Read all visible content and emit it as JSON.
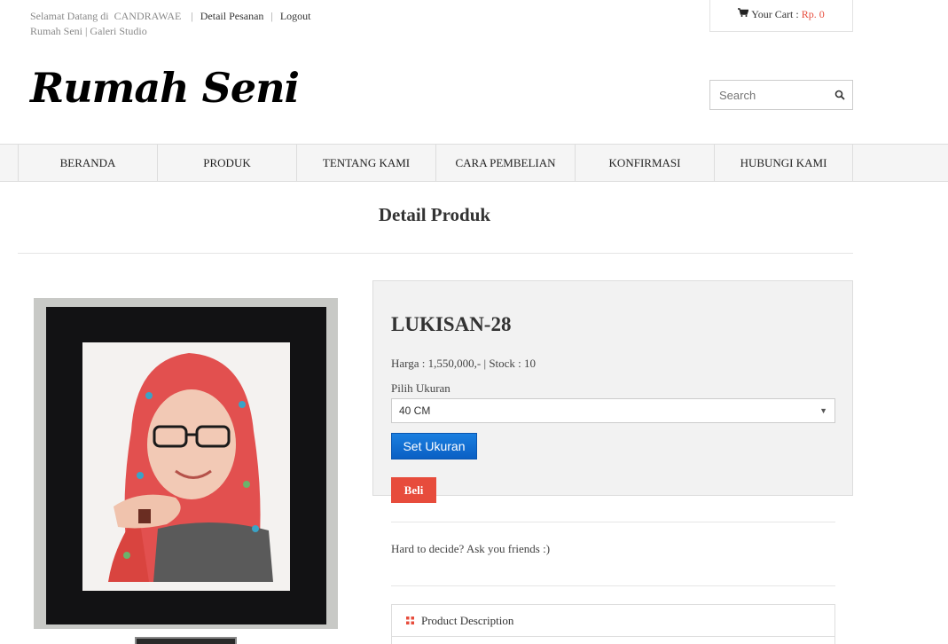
{
  "topbar": {
    "welcome": "Selamat Datang di",
    "username": "CANDRAWAE",
    "order_detail": "Detail Pesanan",
    "logout": "Logout",
    "subtitle": "Rumah Seni | Galeri Studio"
  },
  "cart": {
    "icon": "cart-icon",
    "label": "Your Cart :",
    "amount": "Rp. 0",
    "accent": "#e74c3c"
  },
  "logo": {
    "text": "Rumah Seni"
  },
  "search": {
    "placeholder": "Search",
    "icon": "search-icon"
  },
  "nav": {
    "items": [
      "BERANDA",
      "PRODUK",
      "TENTANG KAMI",
      "CARA PEMBELIAN",
      "KONFIRMASI",
      "HUBUNGI KAMI"
    ]
  },
  "page": {
    "title": "Detail Produk"
  },
  "product": {
    "name": "LUKISAN-28",
    "price_line": "Harga : 1,550,000,- | Stock : 10",
    "size_label": "Pilih Ukuran",
    "size_selected": "40 CM",
    "set_size_button": "Set Ukuran",
    "buy_button": "Beli",
    "share_text": "Hard to decide? Ask you friends :)",
    "description_tab": "Product Description",
    "button_color": "#0a6fd6",
    "buy_color": "#e74c3c"
  }
}
